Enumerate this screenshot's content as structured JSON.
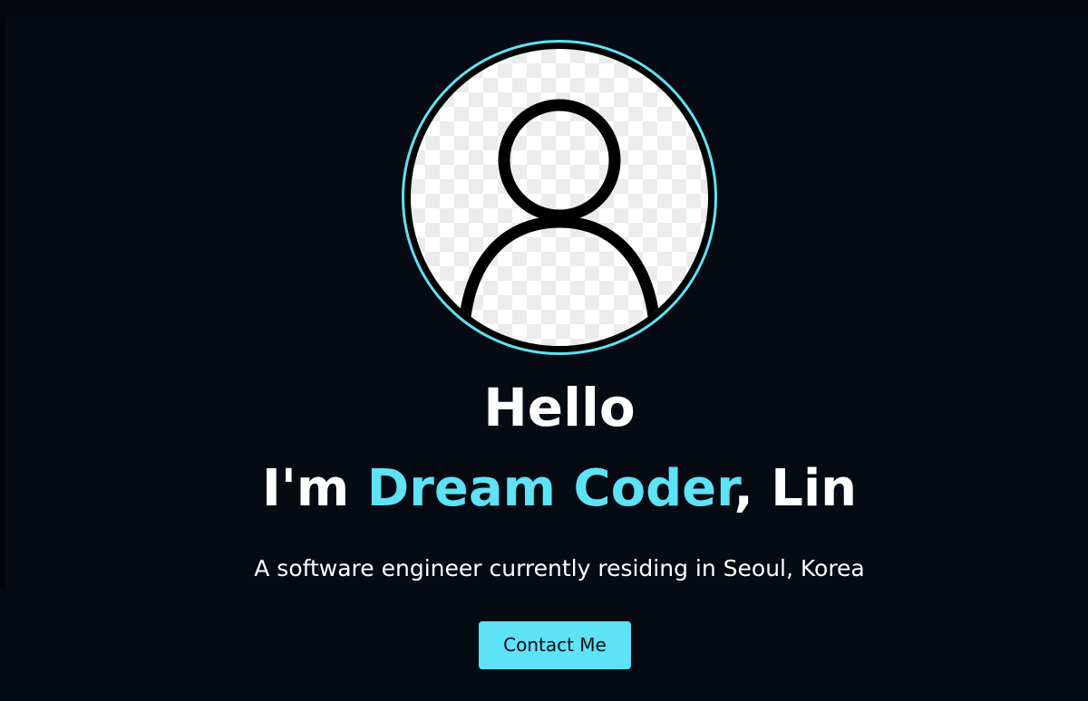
{
  "theme": {
    "accent": "#5ee2f5",
    "background": "#050a13",
    "text": "#ffffff"
  },
  "home": {
    "avatar_icon": "user-avatar-icon",
    "greeting": "Hello",
    "title_prefix": "I'm ",
    "title_highlight": "Dream Coder",
    "title_suffix": ", Lin",
    "description": "A software engineer currently residing in Seoul, Korea",
    "contact_button": "Contact Me"
  }
}
